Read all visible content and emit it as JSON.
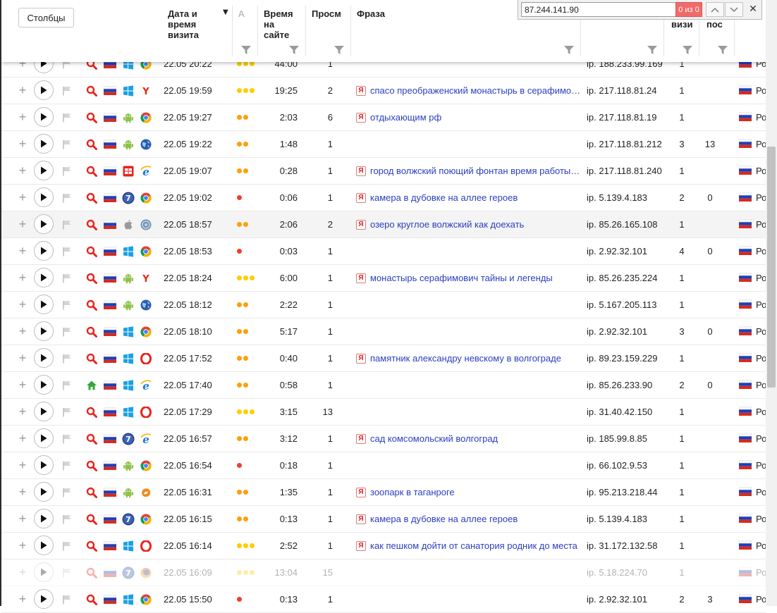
{
  "toolbar": {
    "columns_button": "Столбцы"
  },
  "header": {
    "date_col": "Дата и\nвремя\nвизита",
    "a_col": "А",
    "time_col": "Время\nна\nсайте",
    "views_col": "Просм",
    "phrase_col": "Фраза",
    "visits_col": "визи",
    "depth_col": "пос"
  },
  "find": {
    "query": "87.244.141.90",
    "count": "0 из 0",
    "close": "✕"
  },
  "colors": {
    "dot_red": "#f03e2c",
    "dot_orange": "#ff9f0a",
    "dot_yellow": "#ffcc00",
    "phrase_link": "#2b3ec0",
    "find_count_bg": "#f26a6a"
  },
  "rows": [
    {
      "src": "search",
      "os": "windows",
      "browser": "chrome",
      "datetime": "22.05 20:22",
      "dots": 3,
      "time": "44:00",
      "views": "1",
      "phrase": "",
      "ip": "ip. 188.233.99.169",
      "visits": "1",
      "depth": "",
      "region": "Рос"
    },
    {
      "src": "search",
      "os": "windows",
      "browser": "yandex",
      "datetime": "22.05 19:59",
      "dots": 3,
      "time": "19:25",
      "views": "2",
      "phrase": "спасо преображенский монастырь в серафимович",
      "ip": "ip. 217.118.81.24",
      "visits": "1",
      "depth": "",
      "region": "Рос"
    },
    {
      "src": "search",
      "os": "android",
      "browser": "chrome",
      "datetime": "22.05 19:27",
      "dots": 2,
      "time": "2:03",
      "views": "6",
      "phrase": "отдыхающим рф",
      "ip": "ip. 217.118.81.19",
      "visits": "1",
      "depth": "",
      "region": "Рос"
    },
    {
      "src": "search",
      "os": "android",
      "browser": "globe",
      "datetime": "22.05 19:22",
      "dots": 2,
      "time": "1:48",
      "views": "1",
      "phrase": "",
      "ip": "ip. 217.118.81.212",
      "visits": "3",
      "depth": "13",
      "region": "Рос"
    },
    {
      "src": "search",
      "os": "windows-old",
      "browser": "ie",
      "datetime": "22.05 19:07",
      "dots": 2,
      "time": "0:28",
      "views": "1",
      "phrase": "город волжский поющий фонтан время работы фонтана",
      "ip": "ip. 217.118.81.240",
      "visits": "1",
      "depth": "",
      "region": "Рос"
    },
    {
      "src": "search",
      "os": "win7",
      "browser": "chrome",
      "datetime": "22.05 19:02",
      "dots": 1,
      "time": "0:06",
      "views": "1",
      "phrase": "камера в дубовке на аллее героев",
      "ip": "ip. 5.139.4.183",
      "visits": "2",
      "depth": "0",
      "region": "Рос"
    },
    {
      "src": "search",
      "os": "apple",
      "browser": "globe-gray",
      "datetime": "22.05 18:57",
      "dots": 2,
      "time": "2:06",
      "views": "2",
      "phrase": "озеро круглое волжский как доехать",
      "ip": "ip. 85.26.165.108",
      "visits": "1",
      "depth": "",
      "region": "Рос",
      "highlight": true
    },
    {
      "src": "search",
      "os": "windows",
      "browser": "chrome",
      "datetime": "22.05 18:53",
      "dots": 1,
      "time": "0:03",
      "views": "1",
      "phrase": "",
      "ip": "ip. 2.92.32.101",
      "visits": "4",
      "depth": "0",
      "region": "Рос"
    },
    {
      "src": "search",
      "os": "android",
      "browser": "yandex",
      "datetime": "22.05 18:24",
      "dots": 3,
      "time": "6:00",
      "views": "1",
      "phrase": "монастырь серафимович тайны и легенды",
      "ip": "ip. 85.26.235.224",
      "visits": "1",
      "depth": "",
      "region": "Рос"
    },
    {
      "src": "search",
      "os": "android",
      "browser": "globe",
      "datetime": "22.05 18:12",
      "dots": 2,
      "time": "2:22",
      "views": "1",
      "phrase": "",
      "ip": "ip. 5.167.205.113",
      "visits": "1",
      "depth": "",
      "region": "Рос"
    },
    {
      "src": "search",
      "os": "windows",
      "browser": "chrome",
      "datetime": "22.05 18:10",
      "dots": 2,
      "time": "5:17",
      "views": "1",
      "phrase": "",
      "ip": "ip. 2.92.32.101",
      "visits": "3",
      "depth": "0",
      "region": "Рос"
    },
    {
      "src": "search",
      "os": "windows",
      "browser": "opera",
      "datetime": "22.05 17:52",
      "dots": 2,
      "time": "0:40",
      "views": "1",
      "phrase": "памятник александру невскому в волгограде",
      "ip": "ip. 89.23.159.229",
      "visits": "1",
      "depth": "",
      "region": "Рос"
    },
    {
      "src": "home",
      "os": "windows",
      "browser": "ie",
      "datetime": "22.05 17:40",
      "dots": 2,
      "time": "0:58",
      "views": "1",
      "phrase": "",
      "ip": "ip. 85.26.233.90",
      "visits": "2",
      "depth": "0",
      "region": "Рос"
    },
    {
      "src": "search",
      "os": "windows",
      "browser": "opera",
      "datetime": "22.05 17:29",
      "dots": 3,
      "time": "3:15",
      "views": "13",
      "phrase": "",
      "ip": "ip. 31.40.42.150",
      "visits": "1",
      "depth": "",
      "region": "Рос"
    },
    {
      "src": "search",
      "os": "win7",
      "browser": "ie",
      "datetime": "22.05 16:57",
      "dots": 2,
      "time": "3:12",
      "views": "1",
      "phrase": "сад комсомольский волгоград",
      "ip": "ip. 185.99.8.85",
      "visits": "1",
      "depth": "",
      "region": "Рос"
    },
    {
      "src": "search",
      "os": "android",
      "browser": "chrome",
      "datetime": "22.05 16:54",
      "dots": 1,
      "time": "0:18",
      "views": "1",
      "phrase": "",
      "ip": "ip. 66.102.9.53",
      "visits": "1",
      "depth": "",
      "region": "Рос"
    },
    {
      "src": "search",
      "os": "android",
      "browser": "uc",
      "datetime": "22.05 16:31",
      "dots": 2,
      "time": "1:35",
      "views": "1",
      "phrase": "зоопарк в таганроге",
      "ip": "ip. 95.213.218.44",
      "visits": "1",
      "depth": "",
      "region": "Рос"
    },
    {
      "src": "search",
      "os": "win7",
      "browser": "chrome",
      "datetime": "22.05 16:15",
      "dots": 2,
      "time": "0:13",
      "views": "1",
      "phrase": "камера в дубовке на аллее героев",
      "ip": "ip. 5.139.4.183",
      "visits": "1",
      "depth": "",
      "region": "Рос"
    },
    {
      "src": "search",
      "os": "windows",
      "browser": "opera",
      "datetime": "22.05 16:14",
      "dots": 3,
      "time": "2:52",
      "views": "1",
      "phrase": "как пешком дойти от санатория родник до места",
      "ip": "ip. 31.172.132.58",
      "visits": "1",
      "depth": "",
      "region": "Рос"
    },
    {
      "src": "search",
      "os": "win7",
      "browser": "firefox",
      "datetime": "22.05 16:09",
      "dots": 3,
      "time": "13:04",
      "views": "15",
      "phrase": "",
      "ip": "ip. 5.18.224.70",
      "visits": "1",
      "depth": "",
      "region": "Рос",
      "faded": true
    },
    {
      "src": "search",
      "os": "windows",
      "browser": "chrome",
      "datetime": "22.05 15:50",
      "dots": 1,
      "time": "0:13",
      "views": "1",
      "phrase": "",
      "ip": "ip. 2.92.32.101",
      "visits": "2",
      "depth": "3",
      "region": "Рос"
    }
  ]
}
